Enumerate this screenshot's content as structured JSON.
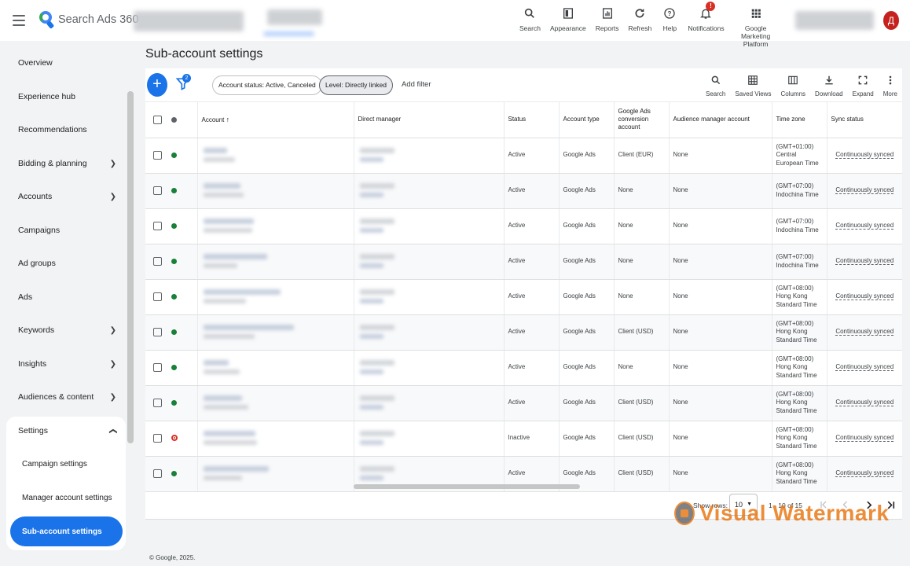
{
  "app": {
    "title": "Search Ads 360",
    "avatar_letter": "Д"
  },
  "topbar_tools": [
    {
      "label": "Search",
      "icon": "search-icon"
    },
    {
      "label": "Appearance",
      "icon": "appearance-icon"
    },
    {
      "label": "Reports",
      "icon": "reports-icon"
    },
    {
      "label": "Refresh",
      "icon": "refresh-icon"
    },
    {
      "label": "Help",
      "icon": "help-icon"
    },
    {
      "label": "Notifications",
      "icon": "bell-icon",
      "badge": "!"
    },
    {
      "label": "Google Marketing Platform",
      "icon": "apps-grid-icon"
    }
  ],
  "sidebar": {
    "items": [
      {
        "label": "Overview",
        "expandable": false
      },
      {
        "label": "Experience hub",
        "expandable": false
      },
      {
        "label": "Recommendations",
        "expandable": false
      },
      {
        "label": "Bidding & planning",
        "expandable": true
      },
      {
        "label": "Accounts",
        "expandable": true
      },
      {
        "label": "Campaigns",
        "expandable": false
      },
      {
        "label": "Ad groups",
        "expandable": false
      },
      {
        "label": "Ads",
        "expandable": false
      },
      {
        "label": "Keywords",
        "expandable": true
      },
      {
        "label": "Insights",
        "expandable": true
      },
      {
        "label": "Audiences & content",
        "expandable": true
      },
      {
        "label": "Settings",
        "expandable": true,
        "expanded": true
      }
    ],
    "settings_sub": [
      {
        "label": "Campaign settings",
        "active": false
      },
      {
        "label": "Manager account settings",
        "active": false
      },
      {
        "label": "Sub-account settings",
        "active": true
      }
    ]
  },
  "page": {
    "title": "Sub-account settings"
  },
  "toolbar": {
    "filter_count": "2",
    "chips": [
      {
        "label": "Account status: Active, Canceled",
        "selected": false
      },
      {
        "label": "Level: Directly linked",
        "selected": true
      }
    ],
    "add_filter": "Add filter",
    "actions": [
      {
        "label": "Search",
        "icon": "search-icon"
      },
      {
        "label": "Saved Views",
        "icon": "saved-views-icon"
      },
      {
        "label": "Columns",
        "icon": "columns-icon"
      },
      {
        "label": "Download",
        "icon": "download-icon"
      },
      {
        "label": "Expand",
        "icon": "expand-icon"
      },
      {
        "label": "More",
        "icon": "more-vert-icon"
      }
    ]
  },
  "table": {
    "columns": [
      "Account",
      "Direct manager",
      "Status",
      "Account type",
      "Google Ads conversion account",
      "Audience manager account",
      "Time zone",
      "Sync status"
    ],
    "rows": [
      {
        "status_dot": "green",
        "status": "Active",
        "type": "Google Ads",
        "conversion": "Client (EUR)",
        "audience": "None",
        "timezone": "(GMT+01:00) Central European Time",
        "sync": "Continuously synced"
      },
      {
        "status_dot": "green",
        "status": "Active",
        "type": "Google Ads",
        "conversion": "None",
        "audience": "None",
        "timezone": "(GMT+07:00) Indochina Time",
        "sync": "Continuously synced"
      },
      {
        "status_dot": "green",
        "status": "Active",
        "type": "Google Ads",
        "conversion": "None",
        "audience": "None",
        "timezone": "(GMT+07:00) Indochina Time",
        "sync": "Continuously synced"
      },
      {
        "status_dot": "green",
        "status": "Active",
        "type": "Google Ads",
        "conversion": "None",
        "audience": "None",
        "timezone": "(GMT+07:00) Indochina Time",
        "sync": "Continuously synced"
      },
      {
        "status_dot": "green",
        "status": "Active",
        "type": "Google Ads",
        "conversion": "None",
        "audience": "None",
        "timezone": "(GMT+08:00) Hong Kong Standard Time",
        "sync": "Continuously synced"
      },
      {
        "status_dot": "green",
        "status": "Active",
        "type": "Google Ads",
        "conversion": "Client (USD)",
        "audience": "None",
        "timezone": "(GMT+08:00) Hong Kong Standard Time",
        "sync": "Continuously synced"
      },
      {
        "status_dot": "green",
        "status": "Active",
        "type": "Google Ads",
        "conversion": "None",
        "audience": "None",
        "timezone": "(GMT+08:00) Hong Kong Standard Time",
        "sync": "Continuously synced"
      },
      {
        "status_dot": "green",
        "status": "Active",
        "type": "Google Ads",
        "conversion": "Client (USD)",
        "audience": "None",
        "timezone": "(GMT+08:00) Hong Kong Standard Time",
        "sync": "Continuously synced"
      },
      {
        "status_dot": "red",
        "status": "Inactive",
        "type": "Google Ads",
        "conversion": "Client (USD)",
        "audience": "None",
        "timezone": "(GMT+08:00) Hong Kong Standard Time",
        "sync": "Continuously synced"
      },
      {
        "status_dot": "green",
        "status": "Active",
        "type": "Google Ads",
        "conversion": "Client (USD)",
        "audience": "None",
        "timezone": "(GMT+08:00) Hong Kong Standard Time",
        "sync": "Continuously synced"
      }
    ]
  },
  "pager": {
    "show_rows_label": "Show rows:",
    "rows_value": "10",
    "range": "1 - 10 of 15"
  },
  "watermark": "Visual Watermark",
  "footer": "© Google, 2025."
}
